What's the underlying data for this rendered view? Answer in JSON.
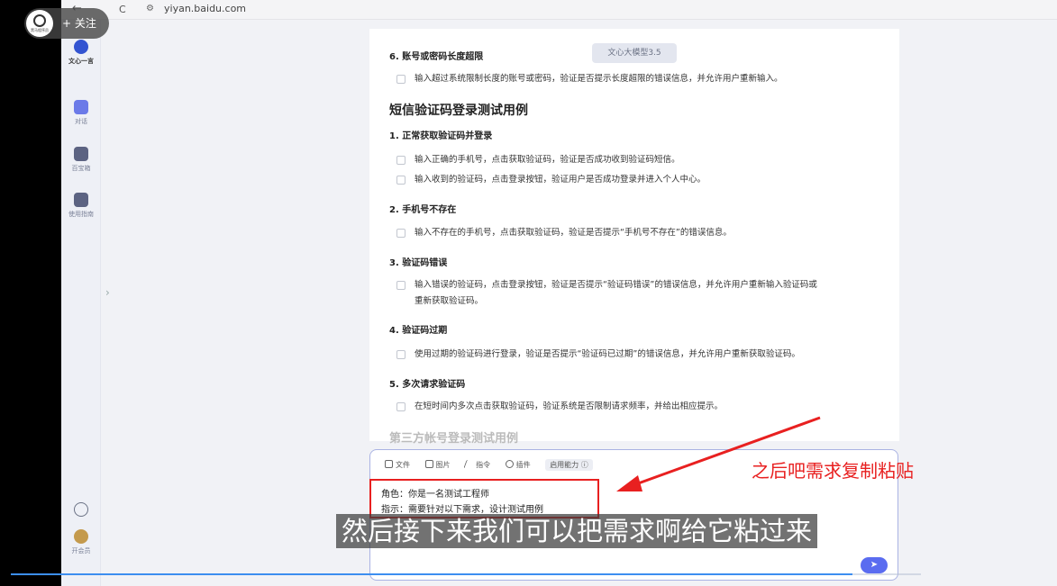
{
  "browser": {
    "url": "yiyan.baidu.com",
    "back": "←",
    "reload": "C"
  },
  "rail": {
    "items": [
      {
        "label": "文心一言",
        "top": 0
      },
      {
        "label": "对话"
      },
      {
        "label": "百宝箱"
      },
      {
        "label": "使用指南"
      },
      {
        "label": "开会员"
      }
    ]
  },
  "doc": {
    "model_chip": "文心大模型3.5",
    "prev_heading": "6. 账号或密码长度超限",
    "prev_item": "输入超过系统限制长度的账号或密码，验证是否提示长度超限的错误信息，并允许用户重新输入。",
    "section_title": "短信验证码登录测试用例",
    "cases": [
      {
        "title": "1. 正常获取验证码并登录",
        "items": [
          "输入正确的手机号，点击获取验证码，验证是否成功收到验证码短信。",
          "输入收到的验证码，点击登录按钮，验证用户是否成功登录并进入个人中心。"
        ]
      },
      {
        "title": "2. 手机号不存在",
        "items": [
          "输入不存在的手机号，点击获取验证码，验证是否提示“手机号不存在”的错误信息。"
        ]
      },
      {
        "title": "3. 验证码错误",
        "items": [
          "输入错误的验证码，点击登录按钮，验证是否提示“验证码错误”的错误信息，并允许用户重新输入验证码或",
          "重新获取验证码。"
        ]
      },
      {
        "title": "4. 验证码过期",
        "items": [
          "使用过期的验证码进行登录，验证是否提示“验证码已过期”的错误信息，并允许用户重新获取验证码。"
        ]
      },
      {
        "title": "5. 多次请求验证码",
        "items": [
          "在短时间内多次点击获取验证码，验证系统是否限制请求频率，并给出相应提示。"
        ]
      }
    ],
    "faded_heading": "第三方帐号登录测试用例"
  },
  "input": {
    "tools": [
      "文件",
      "图片",
      "指令",
      "插件"
    ],
    "ability": "启用能力",
    "line1": "角色：你是一名测试工程师",
    "line2": "指示：需要针对以下需求，设计测试用例"
  },
  "annotation": "之后吧需求复制粘贴",
  "subtitle": "然后接下来我们可以把需求啊给它粘过来",
  "follow": {
    "label": "+ 关注",
    "logo_text": "黑马程序员"
  },
  "progress": 0.925,
  "colors": {
    "accent": "#5a6cf0",
    "annotation_red": "#e82020"
  }
}
